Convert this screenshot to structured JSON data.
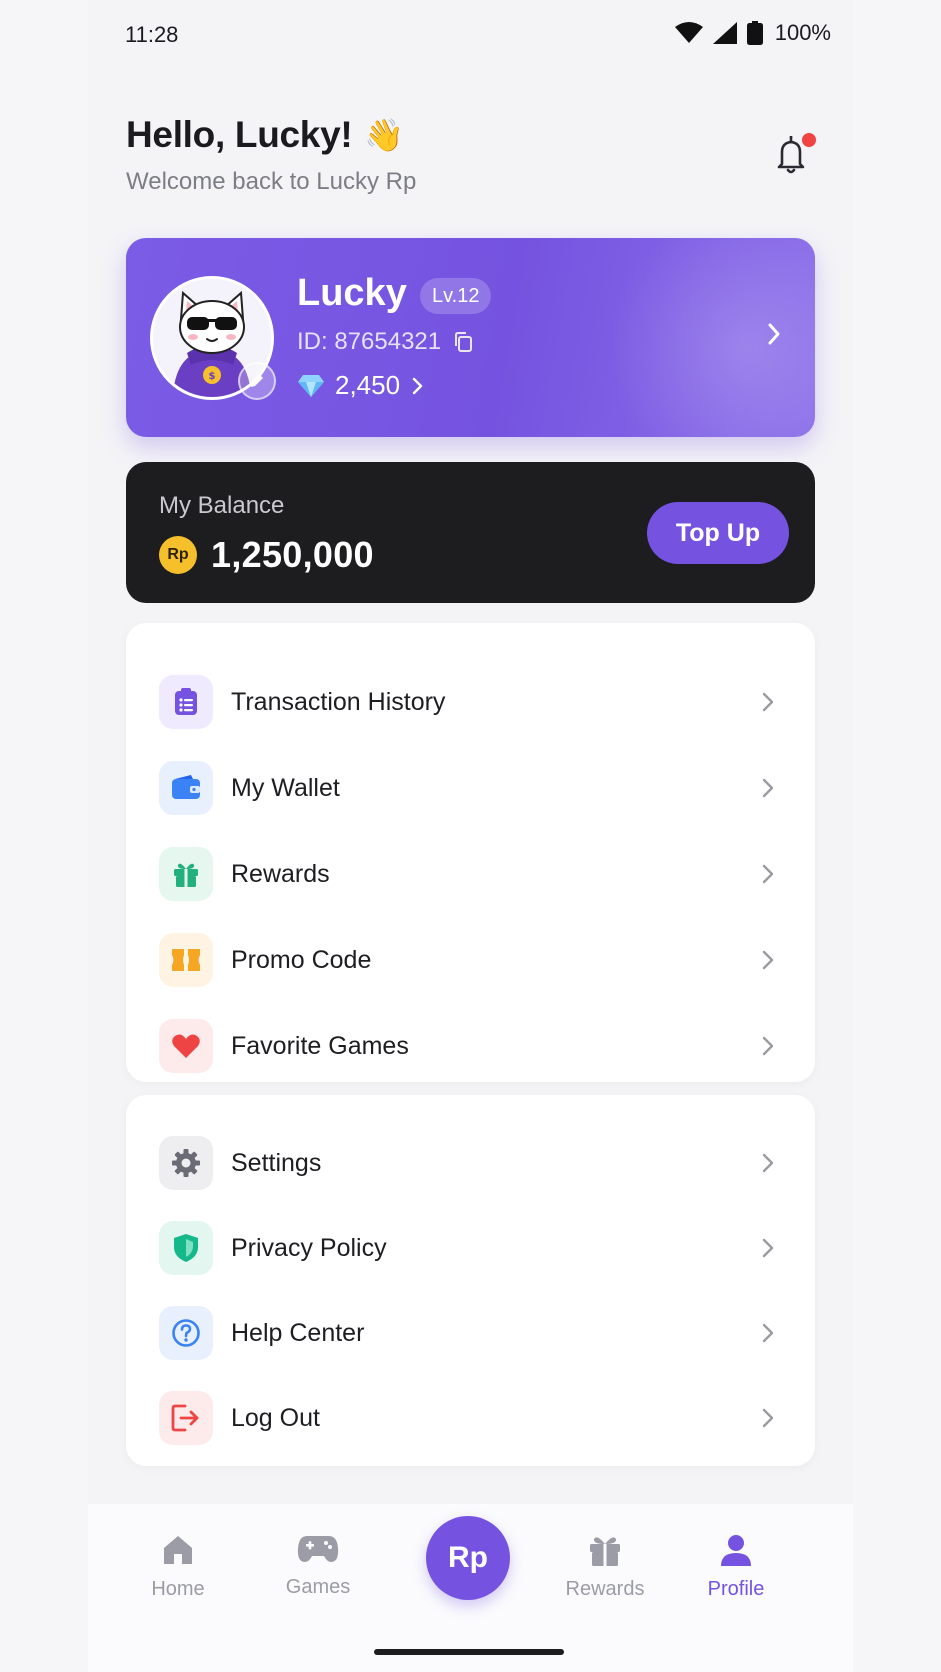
{
  "status_bar": {
    "time": "11:28",
    "battery": "100%"
  },
  "header": {
    "greeting": "Hello, Lucky!",
    "wave": "👋",
    "subtitle": "Welcome back to Lucky Rp",
    "notification_dot": true
  },
  "profile": {
    "name": "Lucky",
    "level": "Lv.12",
    "id": "ID: 87654321",
    "gems": "2,450"
  },
  "balance": {
    "label": "My Balance",
    "currency": "Rp",
    "amount": "1,250,000",
    "top_up_label": "Top Up"
  },
  "menu_primary": [
    {
      "label": "Transaction History",
      "icon": "clipboard-list-icon",
      "color": "#7553e0",
      "bg": "#efeafd"
    },
    {
      "label": "My Wallet",
      "icon": "wallet-icon",
      "color": "#3b82f6",
      "bg": "#e8f0fe"
    },
    {
      "label": "Rewards",
      "icon": "gift-icon",
      "color": "#22b07d",
      "bg": "#e5f7ef"
    },
    {
      "label": "Promo Code",
      "icon": "ticket-icon",
      "color": "#f5a623",
      "bg": "#fff3e3"
    },
    {
      "label": "Favorite Games",
      "icon": "heart-icon",
      "color": "#ef4444",
      "bg": "#fdeaea"
    }
  ],
  "menu_secondary": [
    {
      "label": "Settings",
      "icon": "gear-icon",
      "color": "#6b6b75",
      "bg": "#eeeef1"
    },
    {
      "label": "Privacy Policy",
      "icon": "shield-icon",
      "color": "#14b88a",
      "bg": "#e3f7f0"
    },
    {
      "label": "Help Center",
      "icon": "question-circle-icon",
      "color": "#3b82f6",
      "bg": "#e8f0fe"
    },
    {
      "label": "Log Out",
      "icon": "logout-icon",
      "color": "#ef4444",
      "bg": "#fdeaea"
    }
  ],
  "bottom_nav": {
    "items": [
      {
        "label": "Home",
        "icon": "home-icon"
      },
      {
        "label": "Games",
        "icon": "gamepad-icon"
      },
      {
        "label": "Rewards",
        "icon": "gift-icon"
      },
      {
        "label": "Profile",
        "icon": "user-icon",
        "active": true
      }
    ],
    "center_label": "Rp"
  },
  "colors": {
    "accent": "#7553e0",
    "dark_card": "#1d1d1f",
    "coin": "#f5c02b"
  }
}
